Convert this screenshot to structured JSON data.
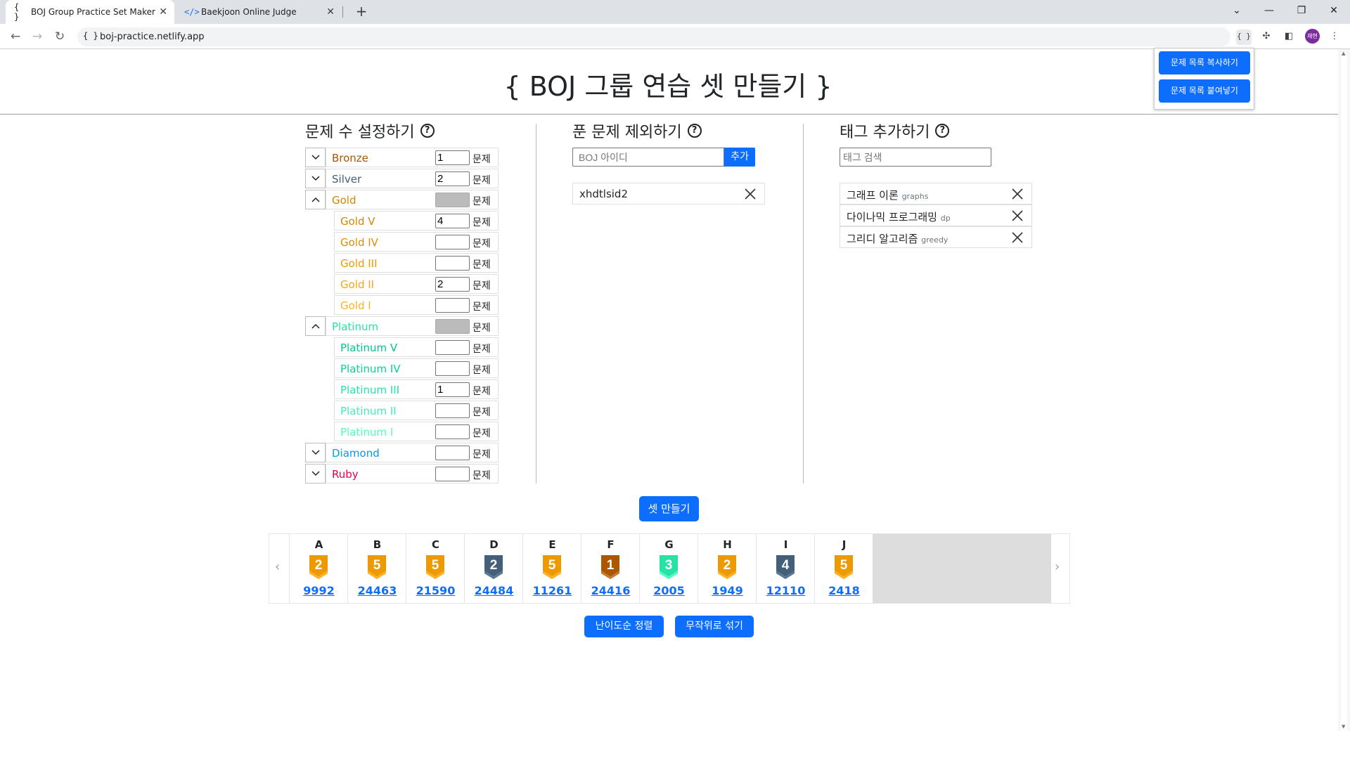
{
  "browser": {
    "tabs": [
      {
        "title": "BOJ Group Practice Set Maker",
        "icon": "{ }"
      },
      {
        "title": "Baekjoon Online Judge",
        "icon": "</>"
      }
    ],
    "url": "boj-practice.netlify.app",
    "site_icon": "{ }",
    "extension_icon": "{ }",
    "avatar_text": "재현"
  },
  "popup": {
    "copy_label": "문제 목록 복사하기",
    "paste_label": "문제 목록 붙여넣기"
  },
  "page": {
    "title": "{ BOJ 그룹 연습 셋 만들기 }",
    "unit": "문제",
    "help_glyph": "?"
  },
  "count_section": {
    "heading": "문제 수 설정하기",
    "tiers": [
      {
        "name": "Bronze",
        "value": "1",
        "expanded": false,
        "color": "#ad5600"
      },
      {
        "name": "Silver",
        "value": "2",
        "expanded": false,
        "color": "#435f7a"
      },
      {
        "name": "Gold",
        "value": "",
        "expanded": true,
        "color": "#d28500",
        "levels": [
          {
            "name": "Gold V",
            "value": "4"
          },
          {
            "name": "Gold IV",
            "value": ""
          },
          {
            "name": "Gold III",
            "value": ""
          },
          {
            "name": "Gold II",
            "value": "2"
          },
          {
            "name": "Gold I",
            "value": ""
          }
        ]
      },
      {
        "name": "Platinum",
        "value": "",
        "expanded": true,
        "color": "#27e2a4",
        "levels": [
          {
            "name": "Platinum V",
            "value": ""
          },
          {
            "name": "Platinum IV",
            "value": ""
          },
          {
            "name": "Platinum III",
            "value": "1"
          },
          {
            "name": "Platinum II",
            "value": ""
          },
          {
            "name": "Platinum I",
            "value": ""
          }
        ]
      },
      {
        "name": "Diamond",
        "value": "",
        "expanded": false,
        "color": "#009ee5"
      },
      {
        "name": "Ruby",
        "value": "",
        "expanded": false,
        "color": "#e0004c"
      }
    ]
  },
  "exclude_section": {
    "heading": "푼 문제 제외하기",
    "input_placeholder": "BOJ 아이디",
    "add_label": "추가",
    "users": [
      "xhdtlsid2"
    ]
  },
  "tag_section": {
    "heading": "태그 추가하기",
    "search_placeholder": "태그 검색",
    "tags": [
      {
        "name": "그래프 이론",
        "key": "graphs"
      },
      {
        "name": "다이나믹 프로그래밍",
        "key": "dp"
      },
      {
        "name": "그리디 알고리즘",
        "key": "greedy"
      }
    ]
  },
  "make_set_label": "셋 만들기",
  "problems": [
    {
      "letter": "A",
      "id": "9992",
      "tier": "gold",
      "level": "2"
    },
    {
      "letter": "B",
      "id": "24463",
      "tier": "gold",
      "level": "5"
    },
    {
      "letter": "C",
      "id": "21590",
      "tier": "gold",
      "level": "5"
    },
    {
      "letter": "D",
      "id": "24484",
      "tier": "silver",
      "level": "2"
    },
    {
      "letter": "E",
      "id": "11261",
      "tier": "gold",
      "level": "5"
    },
    {
      "letter": "F",
      "id": "24416",
      "tier": "bronze",
      "level": "1"
    },
    {
      "letter": "G",
      "id": "2005",
      "tier": "platinum",
      "level": "3"
    },
    {
      "letter": "H",
      "id": "1949",
      "tier": "gold",
      "level": "2"
    },
    {
      "letter": "I",
      "id": "12110",
      "tier": "silver",
      "level": "4"
    },
    {
      "letter": "J",
      "id": "2418",
      "tier": "gold",
      "level": "5"
    }
  ],
  "badge_colors": {
    "gold": {
      "top": "#ec9a00",
      "bottom": "#ffb028"
    },
    "silver": {
      "top": "#435f7a",
      "bottom": "#5d7a95"
    },
    "bronze": {
      "top": "#ad5600",
      "bottom": "#c67739"
    },
    "platinum": {
      "top": "#27e2a4",
      "bottom": "#51fdbd"
    }
  },
  "sort_label": "난이도순 정렬",
  "shuffle_label": "무작위로 섞기"
}
